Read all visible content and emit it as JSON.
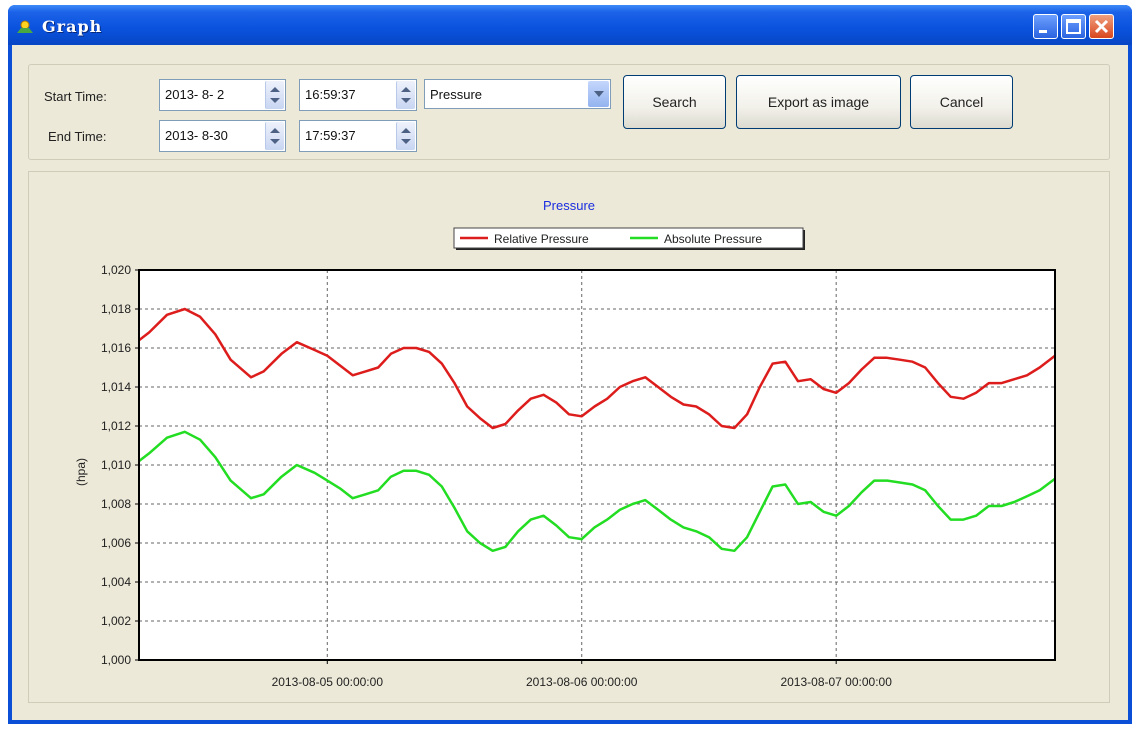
{
  "window": {
    "title": "Graph"
  },
  "controls": {
    "start_label": "Start Time:",
    "end_label": "End Time:",
    "start_date": "2013- 8- 2",
    "start_time": "16:59:37",
    "end_date": "2013- 8-30",
    "end_time": "17:59:37",
    "type_selected": "Pressure",
    "search_label": "Search",
    "export_label": "Export as image",
    "cancel_label": "Cancel"
  },
  "colors": {
    "relative": "#dd1c1c",
    "absolute": "#22dd22",
    "title_color": "#1a2ee0"
  },
  "icons": {
    "app": "sun-icon",
    "minimize": "minimize-icon",
    "maximize": "maximize-icon",
    "close": "close-icon"
  },
  "chart_data": {
    "type": "line",
    "title": "Pressure",
    "ylabel": "(hpa)",
    "xlabel": "",
    "ylim": [
      1000,
      1020
    ],
    "yticks": [
      "1,000",
      "1,002",
      "1,004",
      "1,006",
      "1,008",
      "1,010",
      "1,012",
      "1,014",
      "1,016",
      "1,018",
      "1,020"
    ],
    "x_ticks": [
      "2013-08-05 00:00:00",
      "2013-08-06 00:00:00",
      "2013-08-07 00:00:00"
    ],
    "x_tick_days": [
      0,
      1,
      2
    ],
    "xlim_days": [
      -0.74,
      2.86
    ],
    "grid": true,
    "legend": "top-center",
    "series": [
      {
        "name": "Relative Pressure",
        "x": [
          -0.74,
          -0.7,
          -0.63,
          -0.56,
          -0.5,
          -0.44,
          -0.38,
          -0.3,
          -0.25,
          -0.18,
          -0.12,
          -0.05,
          0.0,
          0.05,
          0.1,
          0.15,
          0.2,
          0.25,
          0.3,
          0.35,
          0.4,
          0.45,
          0.5,
          0.55,
          0.6,
          0.65,
          0.7,
          0.75,
          0.8,
          0.85,
          0.9,
          0.95,
          1.0,
          1.05,
          1.1,
          1.15,
          1.2,
          1.25,
          1.3,
          1.35,
          1.4,
          1.45,
          1.5,
          1.55,
          1.6,
          1.65,
          1.7,
          1.75,
          1.8,
          1.85,
          1.9,
          1.95,
          2.0,
          2.05,
          2.1,
          2.15,
          2.2,
          2.25,
          2.3,
          2.35,
          2.4,
          2.45,
          2.5,
          2.55,
          2.6,
          2.65,
          2.7,
          2.75,
          2.8,
          2.86
        ],
        "y": [
          1016.4,
          1016.8,
          1017.7,
          1018.0,
          1017.6,
          1016.7,
          1015.4,
          1014.5,
          1014.8,
          1015.7,
          1016.3,
          1015.9,
          1015.6,
          1015.1,
          1014.6,
          1014.8,
          1015.0,
          1015.7,
          1016.0,
          1016.0,
          1015.8,
          1015.2,
          1014.2,
          1013.0,
          1012.4,
          1011.9,
          1012.1,
          1012.8,
          1013.4,
          1013.6,
          1013.2,
          1012.6,
          1012.5,
          1013.0,
          1013.4,
          1014.0,
          1014.3,
          1014.5,
          1014.0,
          1013.5,
          1013.1,
          1013.0,
          1012.6,
          1012.0,
          1011.9,
          1012.6,
          1014.0,
          1015.2,
          1015.3,
          1014.3,
          1014.4,
          1013.9,
          1013.7,
          1014.2,
          1014.9,
          1015.5,
          1015.5,
          1015.4,
          1015.3,
          1015.0,
          1014.2,
          1013.5,
          1013.4,
          1013.7,
          1014.2,
          1014.2,
          1014.4,
          1014.6,
          1015.0,
          1015.6
        ]
      },
      {
        "name": "Absolute Pressure",
        "x": [
          -0.74,
          -0.7,
          -0.63,
          -0.56,
          -0.5,
          -0.44,
          -0.38,
          -0.3,
          -0.25,
          -0.18,
          -0.12,
          -0.05,
          0.0,
          0.05,
          0.1,
          0.15,
          0.2,
          0.25,
          0.3,
          0.35,
          0.4,
          0.45,
          0.5,
          0.55,
          0.6,
          0.65,
          0.7,
          0.75,
          0.8,
          0.85,
          0.9,
          0.95,
          1.0,
          1.05,
          1.1,
          1.15,
          1.2,
          1.25,
          1.3,
          1.35,
          1.4,
          1.45,
          1.5,
          1.55,
          1.6,
          1.65,
          1.7,
          1.75,
          1.8,
          1.85,
          1.9,
          1.95,
          2.0,
          2.05,
          2.1,
          2.15,
          2.2,
          2.25,
          2.3,
          2.35,
          2.4,
          2.45,
          2.5,
          2.55,
          2.6,
          2.65,
          2.7,
          2.75,
          2.8,
          2.86
        ],
        "y": [
          1010.2,
          1010.6,
          1011.4,
          1011.7,
          1011.3,
          1010.4,
          1009.2,
          1008.3,
          1008.5,
          1009.4,
          1010.0,
          1009.6,
          1009.2,
          1008.8,
          1008.3,
          1008.5,
          1008.7,
          1009.4,
          1009.7,
          1009.7,
          1009.5,
          1008.9,
          1007.8,
          1006.6,
          1006.0,
          1005.6,
          1005.8,
          1006.6,
          1007.2,
          1007.4,
          1006.9,
          1006.3,
          1006.2,
          1006.8,
          1007.2,
          1007.7,
          1008.0,
          1008.2,
          1007.7,
          1007.2,
          1006.8,
          1006.6,
          1006.3,
          1005.7,
          1005.6,
          1006.3,
          1007.6,
          1008.9,
          1009.0,
          1008.0,
          1008.1,
          1007.6,
          1007.4,
          1007.9,
          1008.6,
          1009.2,
          1009.2,
          1009.1,
          1009.0,
          1008.7,
          1007.9,
          1007.2,
          1007.2,
          1007.4,
          1007.9,
          1007.9,
          1008.1,
          1008.4,
          1008.7,
          1009.3
        ]
      }
    ]
  }
}
